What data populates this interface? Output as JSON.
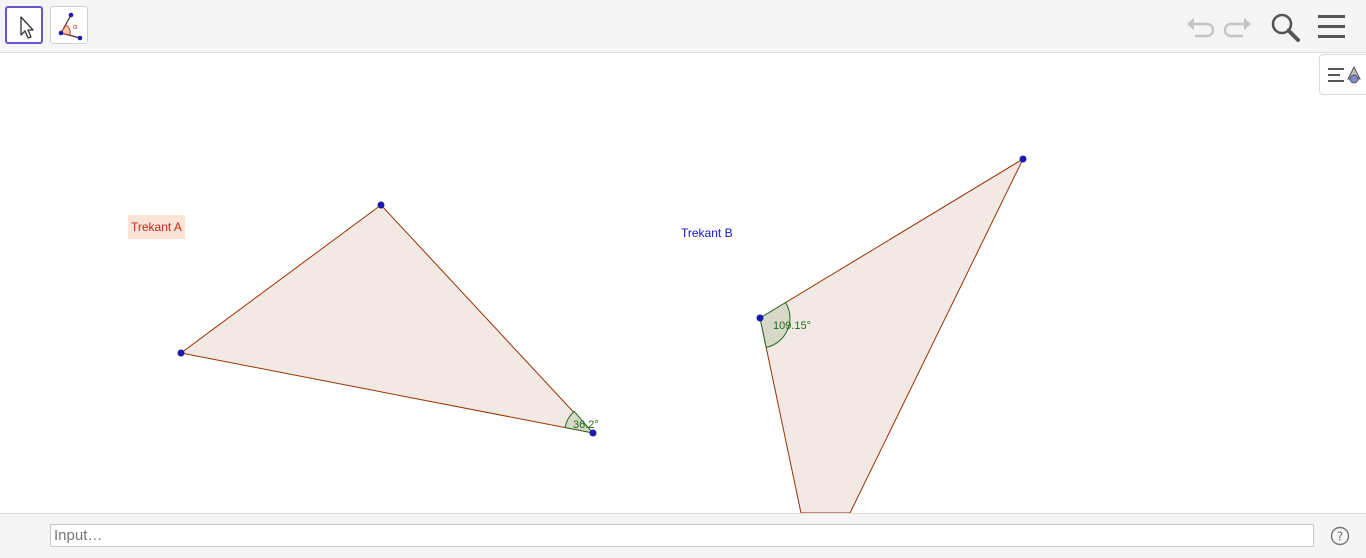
{
  "toolbar": {
    "tools": [
      {
        "name": "move-tool",
        "active": true
      },
      {
        "name": "angle-tool",
        "active": false
      }
    ],
    "icons": [
      "undo-icon",
      "redo-icon",
      "search-icon",
      "menu-icon"
    ]
  },
  "graphics": {
    "triangle_a_label": "Trekant A",
    "triangle_b_label": "Trekant B",
    "angle_a": "36.2°",
    "angle_b": "109.15°",
    "colors": {
      "fill": "#f3e9e4",
      "edge": "#993300",
      "point": "#1a1ab0",
      "angle": "#1f6b1f",
      "label_a": "#c0291b",
      "label_a_bg": "#fbe4d6",
      "label_b": "#1515c8"
    }
  },
  "input_bar": {
    "placeholder": "Input…"
  }
}
